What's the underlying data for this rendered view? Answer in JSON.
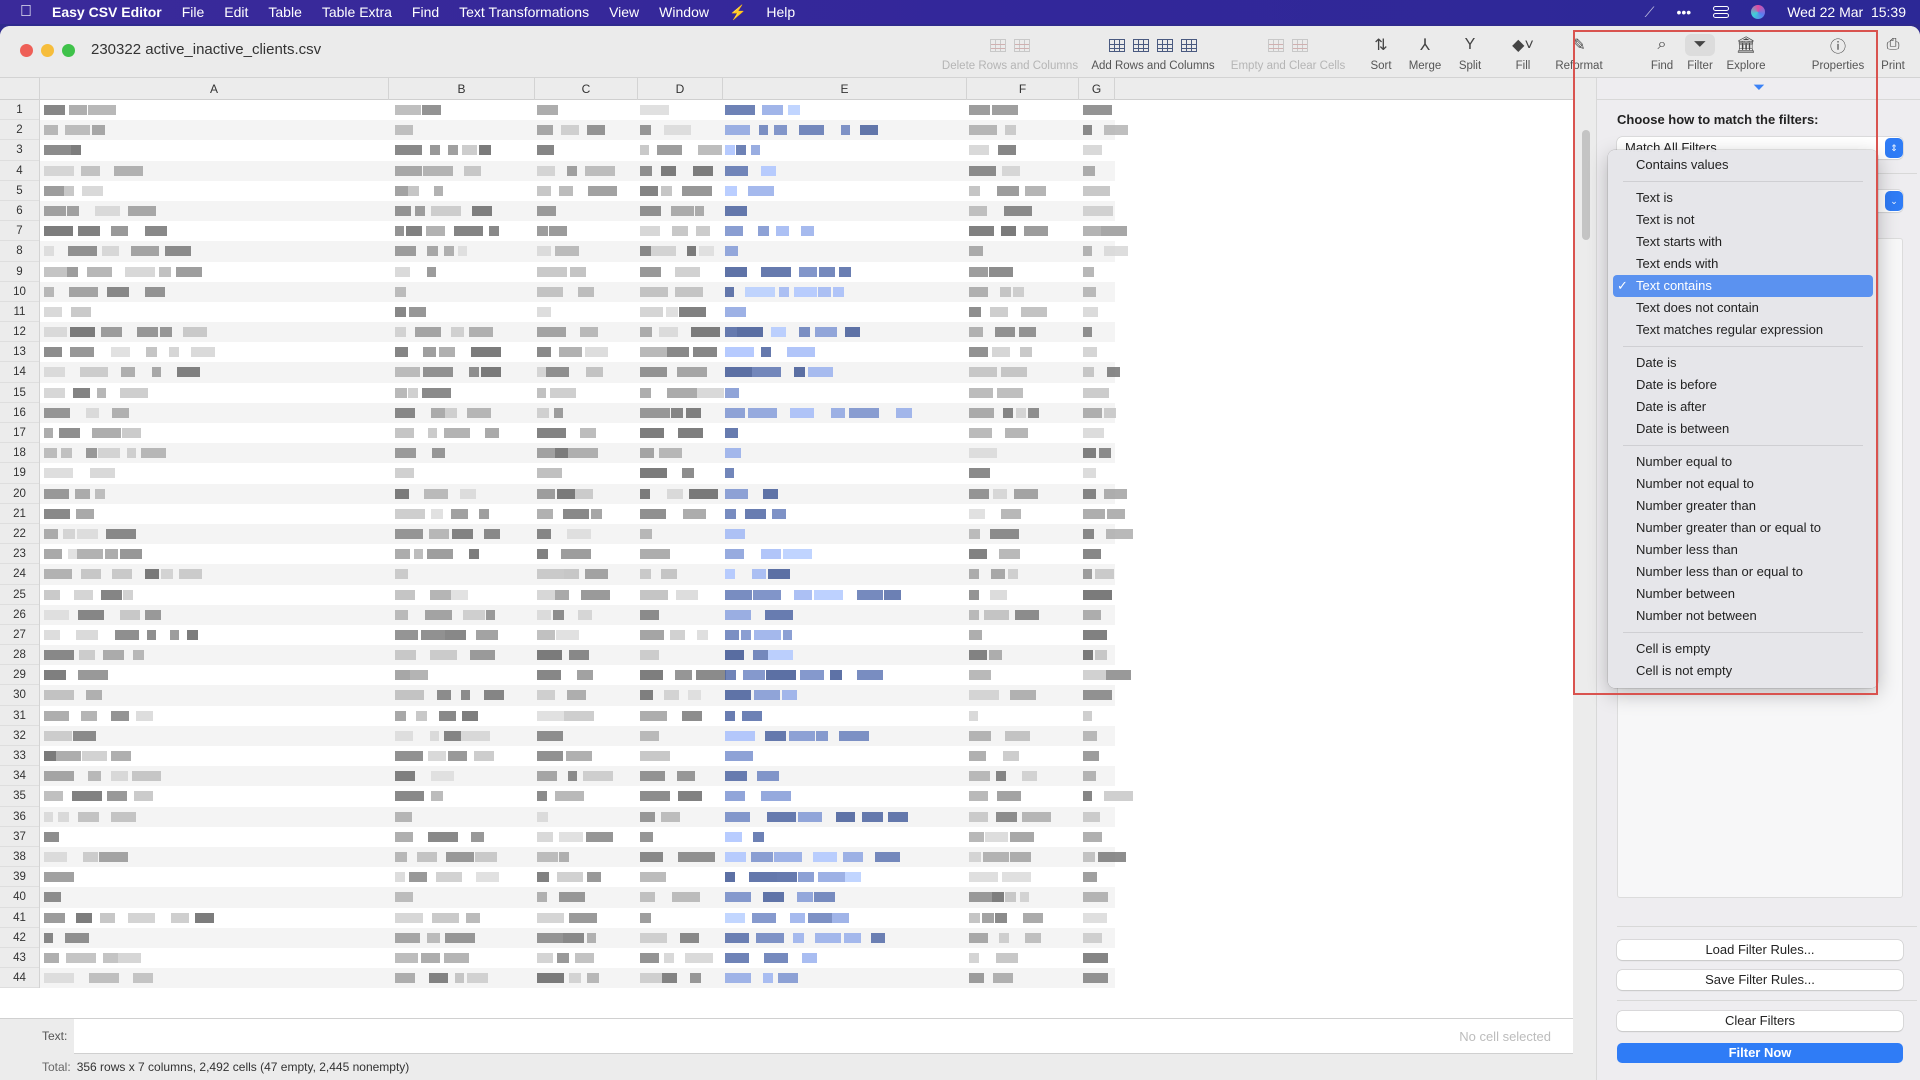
{
  "menubar": {
    "app_name": "Easy CSV Editor",
    "items": [
      "File",
      "Edit",
      "Table",
      "Table Extra",
      "Find",
      "Text Transformations",
      "View",
      "Window",
      "⚡",
      "Help"
    ],
    "datetime": "Wed 22 Mar  15:39"
  },
  "window": {
    "title": "230322 active_inactive_clients.csv",
    "traffic_colors": {
      "close": "#ee5f57",
      "minimize": "#f6bd3b",
      "zoom": "#3fc24a"
    }
  },
  "toolbar": {
    "delete_rows_cols": "Delete Rows and Columns",
    "add_rows_cols": "Add Rows and Columns",
    "empty_clear": "Empty and Clear Cells",
    "sort": "Sort",
    "merge": "Merge",
    "split": "Split",
    "fill": "Fill",
    "reformat": "Reformat",
    "find": "Find",
    "filter": "Filter",
    "explore": "Explore",
    "properties": "Properties",
    "print": "Print"
  },
  "sheet": {
    "columns": [
      "A",
      "B",
      "C",
      "D",
      "E",
      "F",
      "G"
    ],
    "row_count_visible": 44,
    "cell_content": "redacted (pixelated)"
  },
  "textbar": {
    "label": "Text:",
    "value": "No cell selected"
  },
  "status": {
    "label": "Total:",
    "value": "356 rows x 7 columns, 2,492 cells (47 empty, 2,445 nonempty)"
  },
  "filter_panel": {
    "heading": "Choose how to match the filters:",
    "match_mode": "Match All Filters",
    "load_button": "Load Filter Rules...",
    "save_button": "Save Filter Rules...",
    "clear_button": "Clear Filters",
    "filter_button": "Filter Now",
    "accent_color": "#2f7cf6"
  },
  "condition_menu": {
    "selected": "Text contains",
    "groups": [
      [
        "Contains values"
      ],
      [
        "Text is",
        "Text is not",
        "Text starts with",
        "Text ends with",
        "Text contains",
        "Text does not contain",
        "Text matches regular expression"
      ],
      [
        "Date is",
        "Date is before",
        "Date is after",
        "Date is between"
      ],
      [
        "Number equal to",
        "Number not equal to",
        "Number greater than",
        "Number greater than or equal to",
        "Number less than",
        "Number less than or equal to",
        "Number between",
        "Number not between"
      ],
      [
        "Cell is empty",
        "Cell is not empty"
      ]
    ]
  },
  "annotation": {
    "highlight_color": "#d9534f"
  }
}
